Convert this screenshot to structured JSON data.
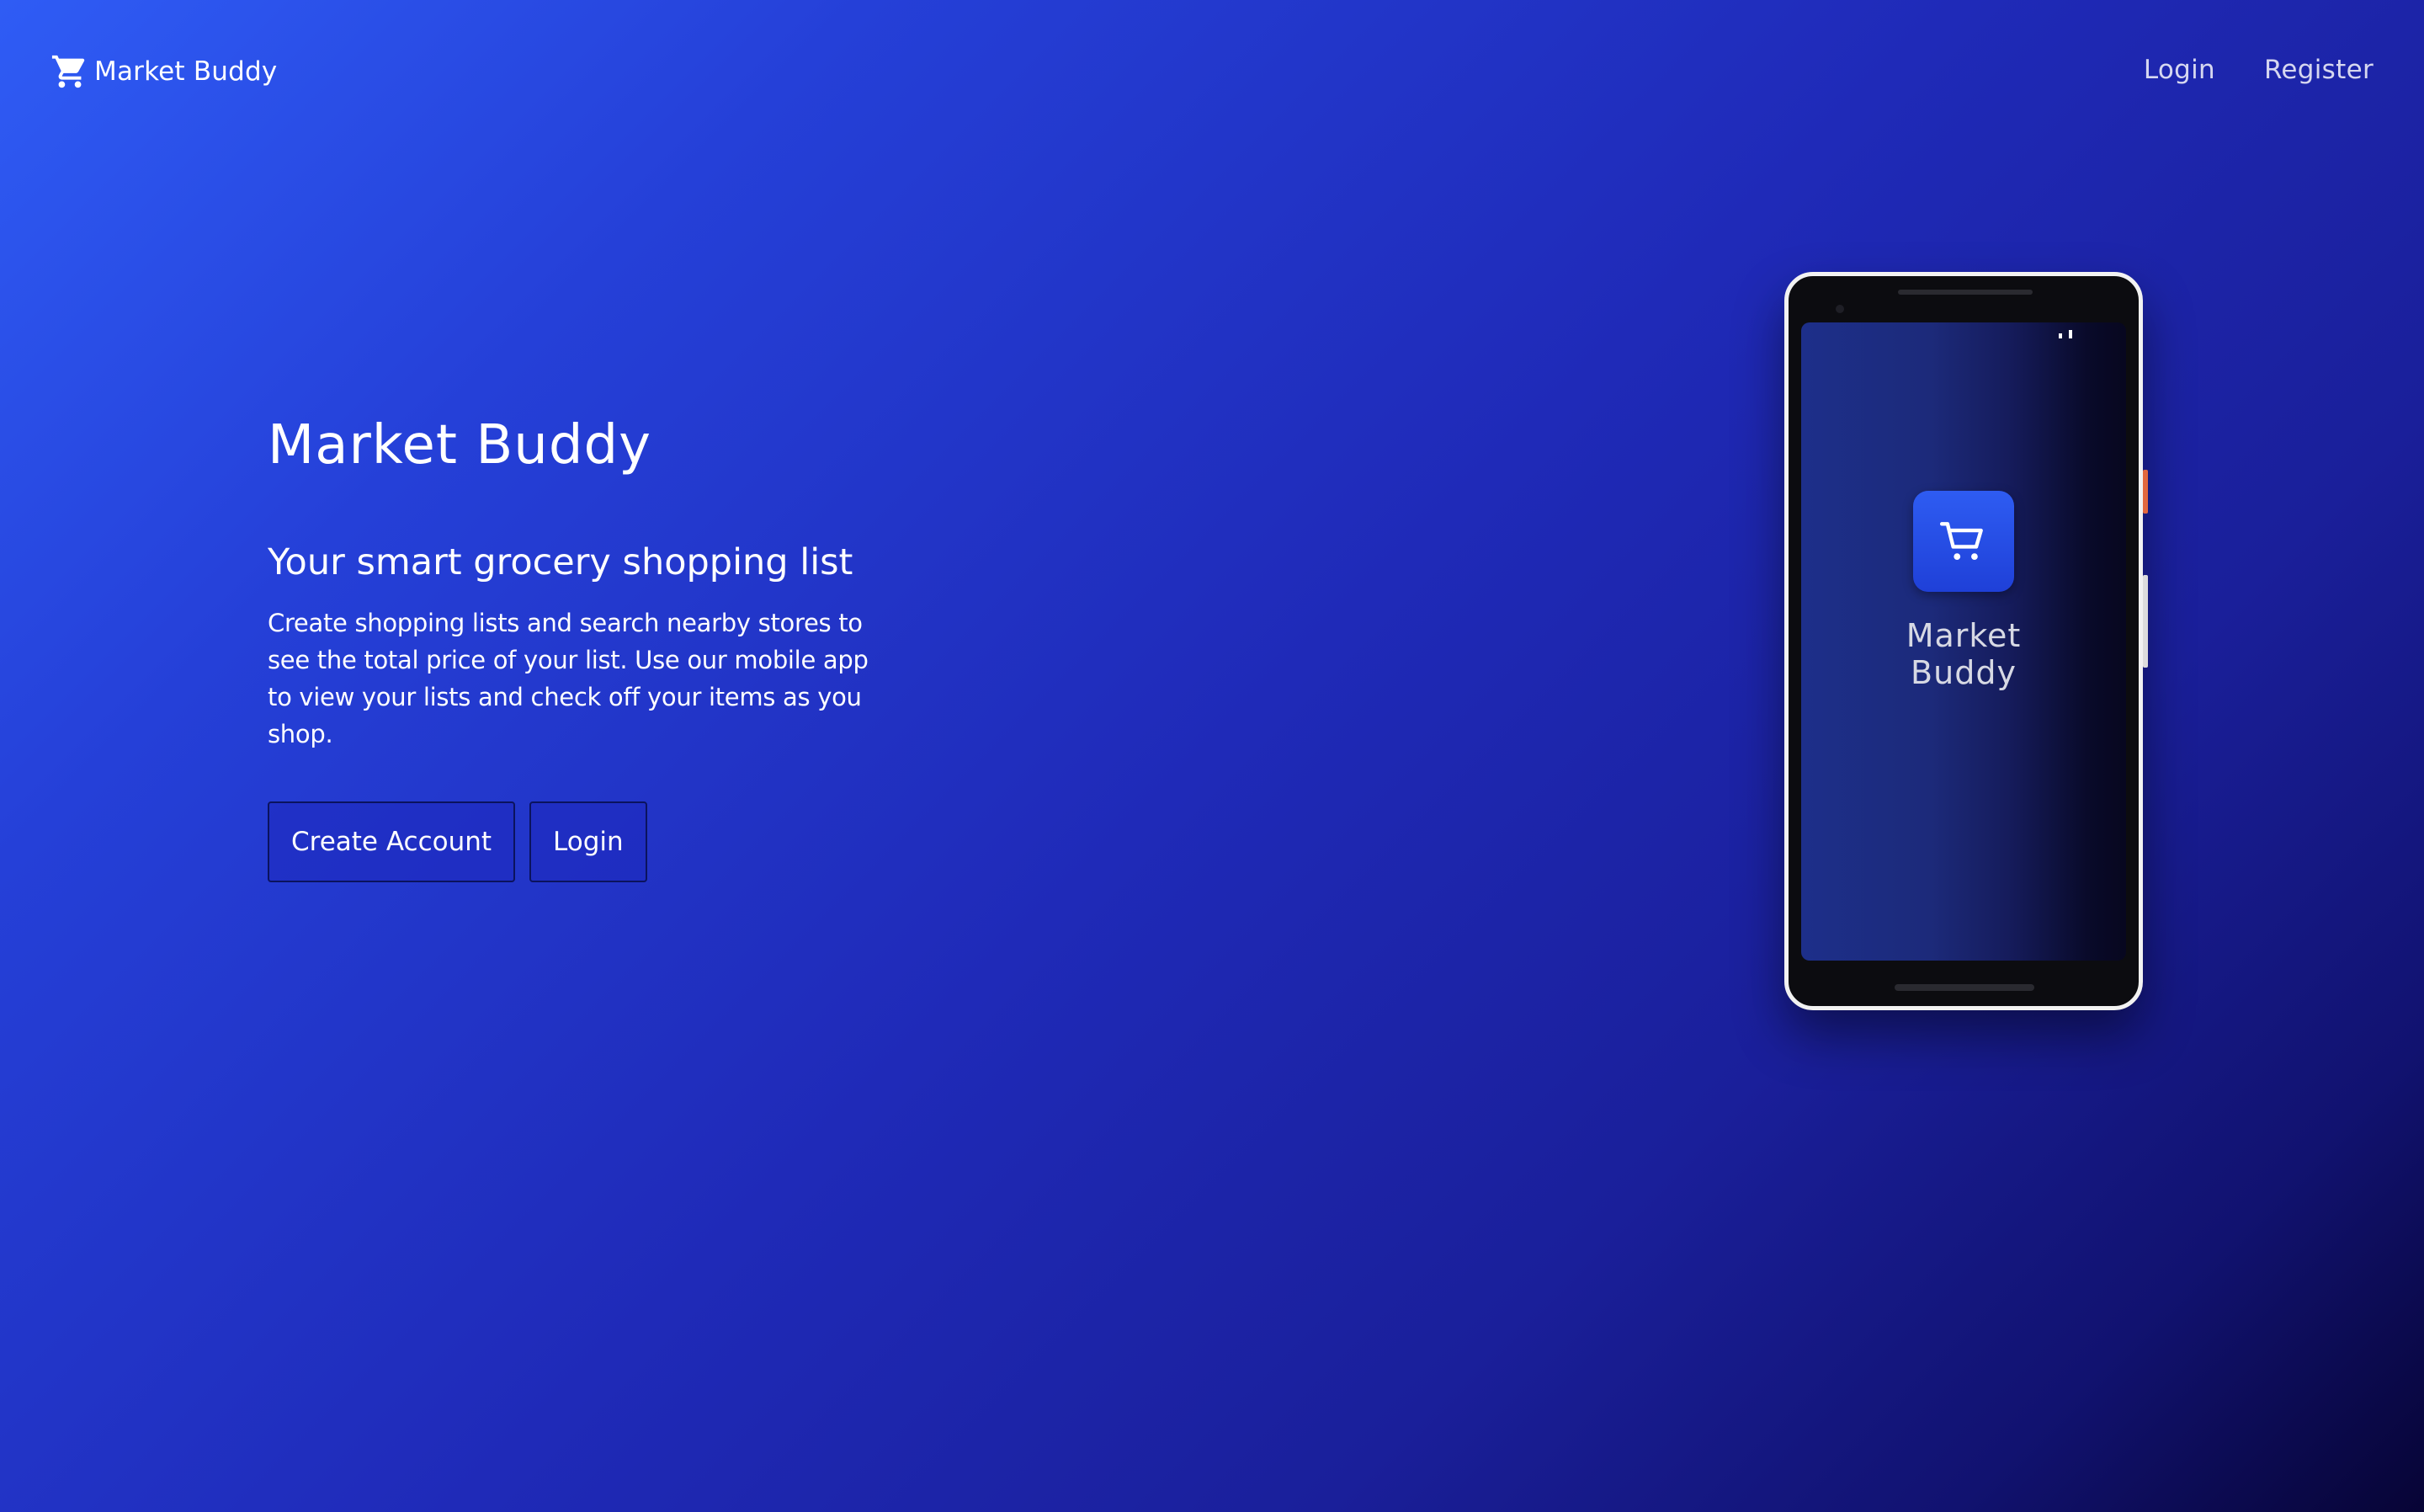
{
  "nav": {
    "brand_name": "Market Buddy",
    "brand_icon": "shopping-cart-icon",
    "links": [
      "Login",
      "Register"
    ]
  },
  "hero": {
    "title": "Market Buddy",
    "subtitle": "Your smart grocery shopping list",
    "description": "Create shopping lists and search nearby stores to see the total price of your list. Use our mobile app to view your lists and check off your items as you shop.",
    "buttons": {
      "create_account": "Create Account",
      "login": "Login"
    }
  },
  "phone": {
    "app_icon": "shopping-cart-icon",
    "app_name_line1": "Market",
    "app_name_line2": "Buddy"
  },
  "colors": {
    "background_start": "#2f5cf5",
    "background_end": "#070435",
    "app_icon": "#2e5cf2",
    "text": "#ffffff"
  }
}
